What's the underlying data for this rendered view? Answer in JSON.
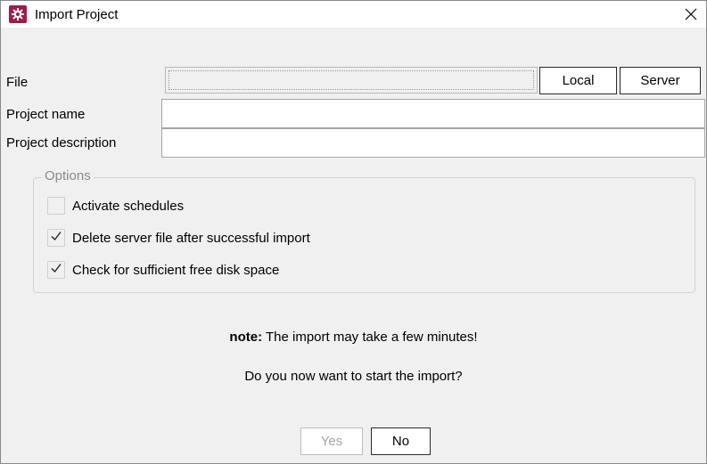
{
  "window": {
    "title": "Import Project",
    "close_label": "×"
  },
  "form": {
    "file_label": "File",
    "file_value": "",
    "local_button": "Local",
    "server_button": "Server",
    "project_name_label": "Project name",
    "project_name_value": "",
    "project_description_label": "Project description",
    "project_description_value": ""
  },
  "options": {
    "legend": "Options",
    "items": [
      {
        "label": "Activate schedules",
        "checked": false
      },
      {
        "label": "Delete server file after successful import",
        "checked": true
      },
      {
        "label": "Check for sufficient free disk space",
        "checked": true
      }
    ]
  },
  "message": {
    "note_prefix": "note:",
    "note_text": " The import may take a few minutes!",
    "question": "Do you now want to start the import?"
  },
  "footer": {
    "yes_button": "Yes",
    "yes_enabled": false,
    "no_button": "No"
  },
  "colors": {
    "app_icon": "#a11a4a",
    "window_bg": "#f0f0f0"
  }
}
